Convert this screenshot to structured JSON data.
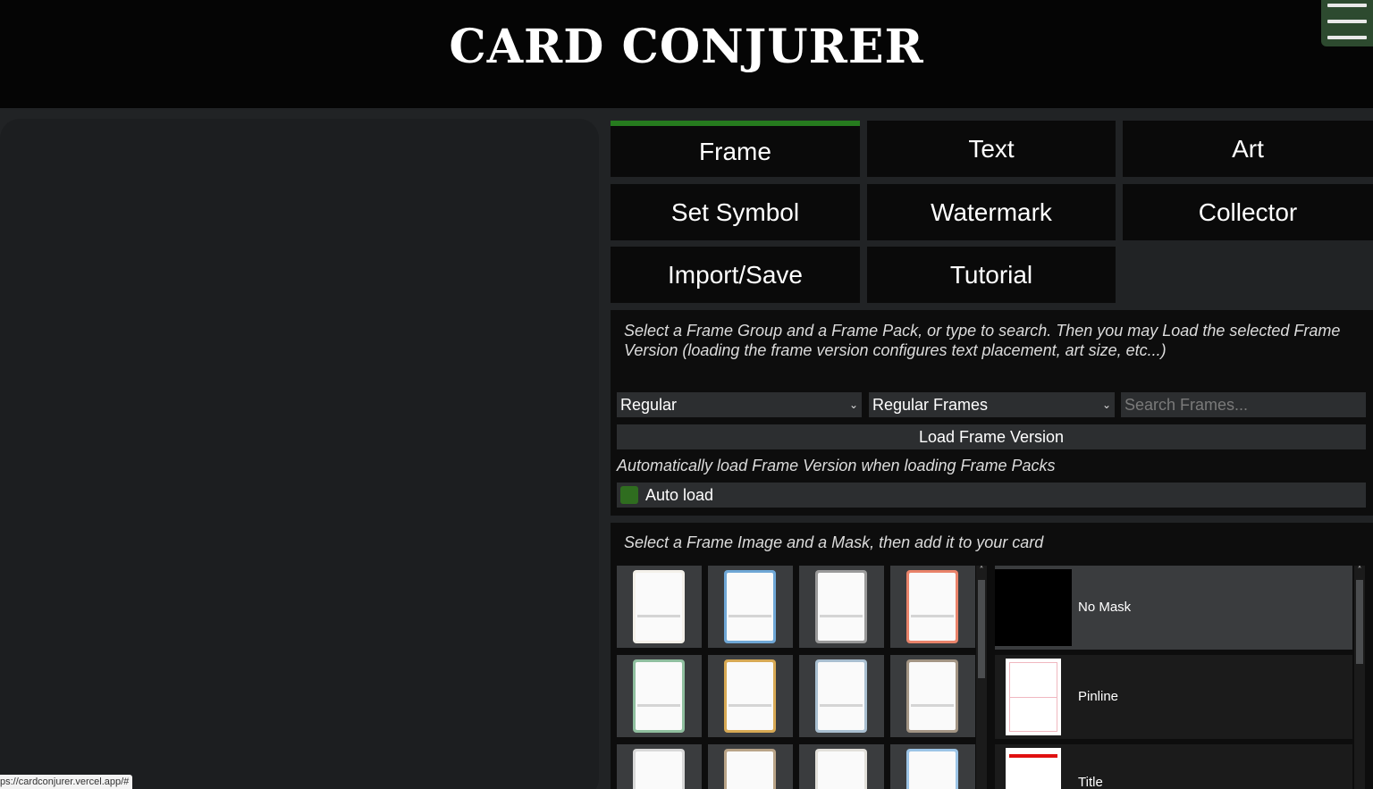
{
  "header": {
    "title": "CARD CONJURER",
    "menu_icon": "hamburger-menu-icon"
  },
  "tabs": [
    {
      "label": "Frame",
      "active": true
    },
    {
      "label": "Text",
      "active": false
    },
    {
      "label": "Art",
      "active": false
    },
    {
      "label": "Set Symbol",
      "active": false
    },
    {
      "label": "Watermark",
      "active": false
    },
    {
      "label": "Collector",
      "active": false
    },
    {
      "label": "Import/Save",
      "active": false
    },
    {
      "label": "Tutorial",
      "active": false
    }
  ],
  "frame_panel": {
    "instructions": "Select a Frame Group and a Frame Pack, or type to search. Then you may Load the selected Frame Version (loading the frame version configures text placement, art size, etc...)",
    "group_select": {
      "value": "Regular"
    },
    "pack_select": {
      "value": "Regular Frames"
    },
    "search": {
      "placeholder": "Search Frames..."
    },
    "load_button": "Load Frame Version",
    "autoload_note": "Automatically load Frame Version when loading Frame Packs",
    "autoload": {
      "label": "Auto load",
      "checked": true
    }
  },
  "image_panel": {
    "instructions": "Select a Frame Image and a Mask, then add it to your card",
    "frame_images": [
      {
        "name": "white-frame-thumb",
        "color": "#f4f1ea"
      },
      {
        "name": "blue-frame-thumb",
        "color": "#6fa7d6"
      },
      {
        "name": "black-frame-thumb",
        "color": "#9a9a9a"
      },
      {
        "name": "red-frame-thumb",
        "color": "#e9836a"
      },
      {
        "name": "green-frame-thumb",
        "color": "#8fbf9f"
      },
      {
        "name": "gold-frame-thumb",
        "color": "#d7a954"
      },
      {
        "name": "artifact-frame-thumb",
        "color": "#a9bfd0"
      },
      {
        "name": "land-frame-thumb",
        "color": "#a39584"
      },
      {
        "name": "colorless-frame-thumb",
        "color": "#d8d8d8"
      },
      {
        "name": "brown-frame-thumb",
        "color": "#b9a488"
      },
      {
        "name": "white-pt-frame-thumb",
        "color": "#e2e0da"
      },
      {
        "name": "blue-pt-frame-thumb",
        "color": "#9cc4e6"
      }
    ],
    "masks": [
      {
        "label": "No Mask",
        "selected": true
      },
      {
        "label": "Pinline",
        "selected": false
      },
      {
        "label": "Title",
        "selected": false
      }
    ]
  },
  "status_bar": {
    "url": "ps://cardconjurer.vercel.app/#"
  }
}
